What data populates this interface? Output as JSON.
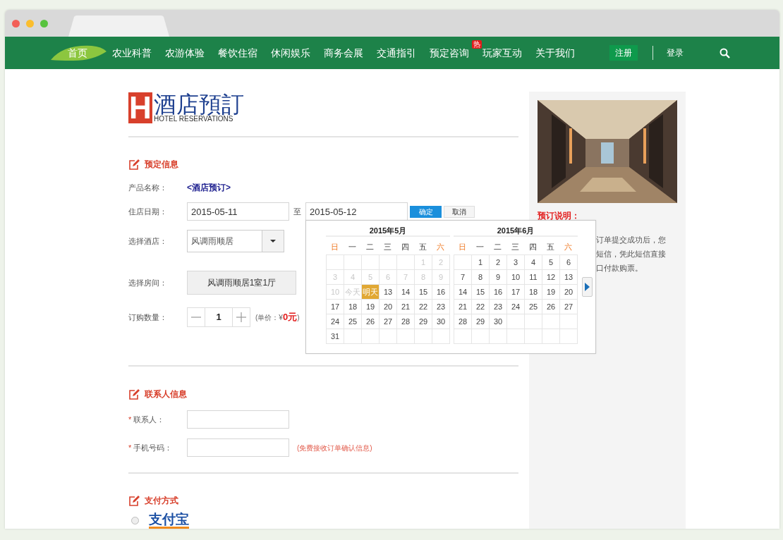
{
  "nav": {
    "items": [
      {
        "label": "首页",
        "selected": true
      },
      {
        "label": "农业科普",
        "selected": false
      },
      {
        "label": "农游体验",
        "selected": false
      },
      {
        "label": "餐饮住宿",
        "selected": false
      },
      {
        "label": "休闲娱乐",
        "selected": false
      },
      {
        "label": "商务会展",
        "selected": false
      },
      {
        "label": "交通指引",
        "selected": false
      },
      {
        "label": "预定咨询",
        "selected": false,
        "badge": "热"
      },
      {
        "label": "玩家互动",
        "selected": false
      },
      {
        "label": "关于我们",
        "selected": false
      }
    ],
    "register": "注册",
    "login": "登录"
  },
  "logo": {
    "mark": "H",
    "title": "酒店預訂",
    "subtitle": "HOTEL RESERVATIONS"
  },
  "booking": {
    "heading": "预定信息",
    "product_label": "产品名称：",
    "product": "<酒店预订>",
    "date_label": "住店日期：",
    "check_in": "2015-05-11",
    "to": "至",
    "check_out": "2015-05-12",
    "confirm": "确定",
    "cancel": "取消",
    "hotel_label": "选择酒店：",
    "hotel": "风调雨顺居",
    "room_label": "选择房间：",
    "room": "风调雨顺居1室1厅",
    "qty_label": "订购数量：",
    "qty": "1",
    "unit_price": "(单价：¥**0元**)"
  },
  "contact": {
    "heading": "联系人信息",
    "fields": [
      {
        "required_mark": "*",
        "label": "联系人："
      },
      {
        "required_mark": "*",
        "label": "手机号码：",
        "hint": "(免费接收订单确认信息)"
      }
    ]
  },
  "payment": {
    "heading": "支付方式",
    "options": [
      {
        "label": "支付宝",
        "selected": false
      }
    ]
  },
  "sidebar": {
    "heading": "预订说明：",
    "lines": [
      "订单提交成功后，您",
      "短信，凭此短信直接",
      "口付款购票。"
    ]
  },
  "calendar": {
    "months": [
      {
        "title": "2015年5月",
        "weekdays": [
          {
            "label": "日",
            "weekend": true
          },
          {
            "label": "一",
            "weekend": false
          },
          {
            "label": "二",
            "weekend": false
          },
          {
            "label": "三",
            "weekend": false
          },
          {
            "label": "四",
            "weekend": false
          },
          {
            "label": "五",
            "weekend": false
          },
          {
            "label": "六",
            "weekend": true
          }
        ],
        "weeks": [
          [
            {
              "kind": "blank"
            },
            {
              "kind": "blank"
            },
            {
              "kind": "blank"
            },
            {
              "kind": "blank"
            },
            {
              "kind": "blank"
            },
            {
              "kind": "day",
              "label": "1",
              "disabled": true,
              "selected": false
            },
            {
              "kind": "day",
              "label": "2",
              "disabled": true,
              "selected": false
            }
          ],
          [
            {
              "kind": "day",
              "label": "3",
              "disabled": true,
              "selected": false
            },
            {
              "kind": "day",
              "label": "4",
              "disabled": true,
              "selected": false
            },
            {
              "kind": "day",
              "label": "5",
              "disabled": true,
              "selected": false
            },
            {
              "kind": "day",
              "label": "6",
              "disabled": true,
              "selected": false
            },
            {
              "kind": "day",
              "label": "7",
              "disabled": true,
              "selected": false
            },
            {
              "kind": "day",
              "label": "8",
              "disabled": true,
              "selected": false
            },
            {
              "kind": "day",
              "label": "9",
              "disabled": true,
              "selected": false
            }
          ],
          [
            {
              "kind": "day",
              "label": "10",
              "disabled": true,
              "selected": false
            },
            {
              "kind": "day",
              "label": "今天",
              "disabled": true,
              "selected": false
            },
            {
              "kind": "day",
              "label": "明天",
              "disabled": false,
              "selected": true
            },
            {
              "kind": "day",
              "label": "13",
              "disabled": false,
              "selected": false
            },
            {
              "kind": "day",
              "label": "14",
              "disabled": false,
              "selected": false
            },
            {
              "kind": "day",
              "label": "15",
              "disabled": false,
              "selected": false
            },
            {
              "kind": "day",
              "label": "16",
              "disabled": false,
              "selected": false
            }
          ],
          [
            {
              "kind": "day",
              "label": "17",
              "disabled": false,
              "selected": false
            },
            {
              "kind": "day",
              "label": "18",
              "disabled": false,
              "selected": false
            },
            {
              "kind": "day",
              "label": "19",
              "disabled": false,
              "selected": false
            },
            {
              "kind": "day",
              "label": "20",
              "disabled": false,
              "selected": false
            },
            {
              "kind": "day",
              "label": "21",
              "disabled": false,
              "selected": false
            },
            {
              "kind": "day",
              "label": "22",
              "disabled": false,
              "selected": false
            },
            {
              "kind": "day",
              "label": "23",
              "disabled": false,
              "selected": false
            }
          ],
          [
            {
              "kind": "day",
              "label": "24",
              "disabled": false,
              "selected": false
            },
            {
              "kind": "day",
              "label": "25",
              "disabled": false,
              "selected": false
            },
            {
              "kind": "day",
              "label": "26",
              "disabled": false,
              "selected": false
            },
            {
              "kind": "day",
              "label": "27",
              "disabled": false,
              "selected": false
            },
            {
              "kind": "day",
              "label": "28",
              "disabled": false,
              "selected": false
            },
            {
              "kind": "day",
              "label": "29",
              "disabled": false,
              "selected": false
            },
            {
              "kind": "day",
              "label": "30",
              "disabled": false,
              "selected": false
            }
          ],
          [
            {
              "kind": "day",
              "label": "31",
              "disabled": false,
              "selected": false
            },
            {
              "kind": "blank"
            },
            {
              "kind": "blank"
            },
            {
              "kind": "blank"
            },
            {
              "kind": "blank"
            },
            {
              "kind": "blank"
            },
            {
              "kind": "blank"
            }
          ]
        ]
      },
      {
        "title": "2015年6月",
        "weekdays": [
          {
            "label": "日",
            "weekend": true
          },
          {
            "label": "一",
            "weekend": false
          },
          {
            "label": "二",
            "weekend": false
          },
          {
            "label": "三",
            "weekend": false
          },
          {
            "label": "四",
            "weekend": false
          },
          {
            "label": "五",
            "weekend": false
          },
          {
            "label": "六",
            "weekend": true
          }
        ],
        "weeks": [
          [
            {
              "kind": "blank"
            },
            {
              "kind": "day",
              "label": "1",
              "disabled": false,
              "selected": false
            },
            {
              "kind": "day",
              "label": "2",
              "disabled": false,
              "selected": false
            },
            {
              "kind": "day",
              "label": "3",
              "disabled": false,
              "selected": false
            },
            {
              "kind": "day",
              "label": "4",
              "disabled": false,
              "selected": false
            },
            {
              "kind": "day",
              "label": "5",
              "disabled": false,
              "selected": false
            },
            {
              "kind": "day",
              "label": "6",
              "disabled": false,
              "selected": false
            }
          ],
          [
            {
              "kind": "day",
              "label": "7",
              "disabled": false,
              "selected": false
            },
            {
              "kind": "day",
              "label": "8",
              "disabled": false,
              "selected": false
            },
            {
              "kind": "day",
              "label": "9",
              "disabled": false,
              "selected": false
            },
            {
              "kind": "day",
              "label": "10",
              "disabled": false,
              "selected": false
            },
            {
              "kind": "day",
              "label": "11",
              "disabled": false,
              "selected": false
            },
            {
              "kind": "day",
              "label": "12",
              "disabled": false,
              "selected": false
            },
            {
              "kind": "day",
              "label": "13",
              "disabled": false,
              "selected": false
            }
          ],
          [
            {
              "kind": "day",
              "label": "14",
              "disabled": false,
              "selected": false
            },
            {
              "kind": "day",
              "label": "15",
              "disabled": false,
              "selected": false
            },
            {
              "kind": "day",
              "label": "16",
              "disabled": false,
              "selected": false
            },
            {
              "kind": "day",
              "label": "17",
              "disabled": false,
              "selected": false
            },
            {
              "kind": "day",
              "label": "18",
              "disabled": false,
              "selected": false
            },
            {
              "kind": "day",
              "label": "19",
              "disabled": false,
              "selected": false
            },
            {
              "kind": "day",
              "label": "20",
              "disabled": false,
              "selected": false
            }
          ],
          [
            {
              "kind": "day",
              "label": "21",
              "disabled": false,
              "selected": false
            },
            {
              "kind": "day",
              "label": "22",
              "disabled": false,
              "selected": false
            },
            {
              "kind": "day",
              "label": "23",
              "disabled": false,
              "selected": false
            },
            {
              "kind": "day",
              "label": "24",
              "disabled": false,
              "selected": false
            },
            {
              "kind": "day",
              "label": "25",
              "disabled": false,
              "selected": false
            },
            {
              "kind": "day",
              "label": "26",
              "disabled": false,
              "selected": false
            },
            {
              "kind": "day",
              "label": "27",
              "disabled": false,
              "selected": false
            }
          ],
          [
            {
              "kind": "day",
              "label": "28",
              "disabled": false,
              "selected": false
            },
            {
              "kind": "day",
              "label": "29",
              "disabled": false,
              "selected": false
            },
            {
              "kind": "day",
              "label": "30",
              "disabled": false,
              "selected": false
            },
            {
              "kind": "blank"
            },
            {
              "kind": "blank"
            },
            {
              "kind": "blank"
            },
            {
              "kind": "blank"
            }
          ],
          [
            {
              "kind": "blank"
            },
            {
              "kind": "blank"
            },
            {
              "kind": "blank"
            },
            {
              "kind": "blank"
            },
            {
              "kind": "blank"
            },
            {
              "kind": "blank"
            },
            {
              "kind": "blank"
            }
          ]
        ]
      }
    ]
  }
}
